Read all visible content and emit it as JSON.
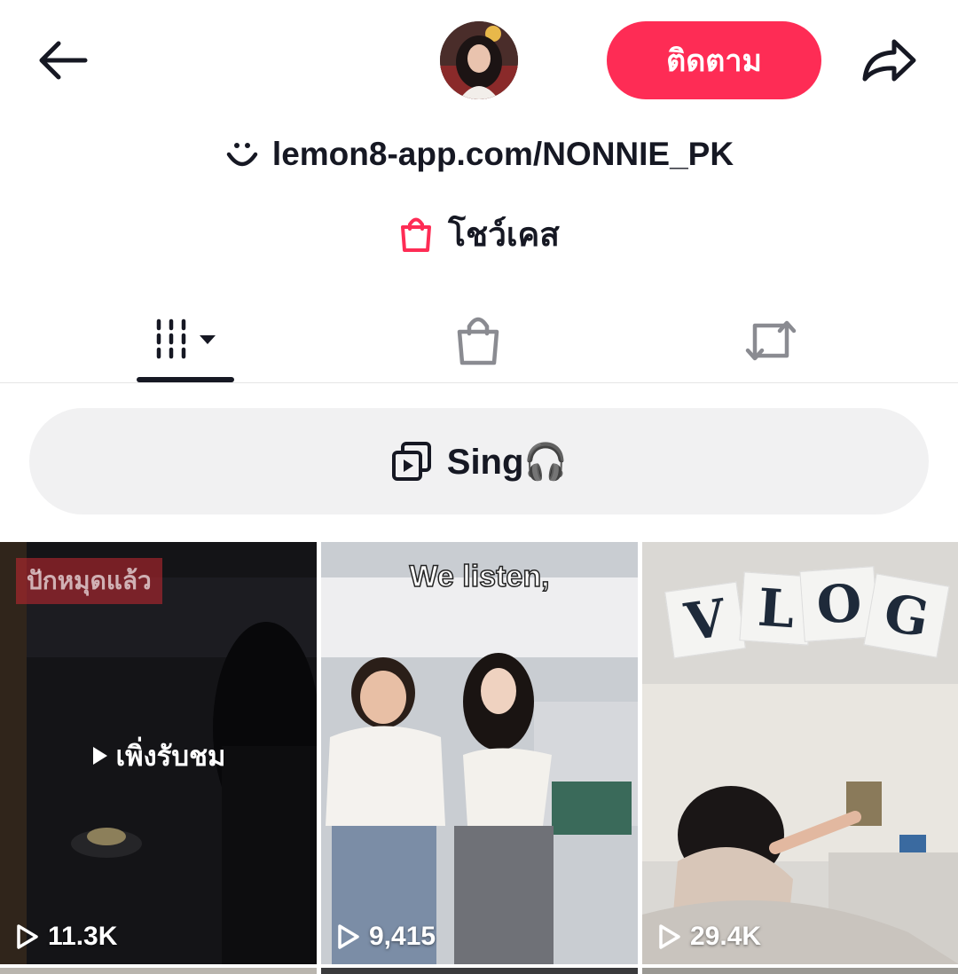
{
  "header": {
    "follow_label": "ติดตาม"
  },
  "profile": {
    "link_text": "lemon8-app.com/NONNIE_PK",
    "showcase_label": "โชว์เคส"
  },
  "tabs": [
    {
      "name": "videos",
      "icon": "grid-icon",
      "active": true
    },
    {
      "name": "shop",
      "icon": "shopping-bag-icon",
      "active": false
    },
    {
      "name": "reposts",
      "icon": "repost-icon",
      "active": false
    }
  ],
  "playlist": {
    "label": "Sing🎧"
  },
  "videos": [
    {
      "views": "11.3K",
      "tag": "ปักหมุดแล้ว",
      "overlay_label": "เพิ่งรับชม"
    },
    {
      "views": "9,415",
      "caption": "We listen,"
    },
    {
      "views": "29.4K",
      "letters": [
        "V",
        "L",
        "O",
        "G"
      ]
    }
  ],
  "colors": {
    "accent": "#fe2c55",
    "text": "#161823",
    "pill_bg": "#f1f1f2"
  }
}
